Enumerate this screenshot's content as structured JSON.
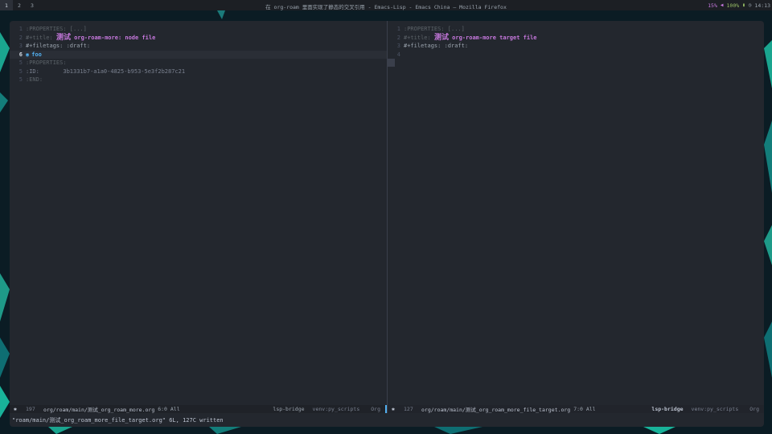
{
  "topbar": {
    "workspaces": [
      "1",
      "2",
      "3"
    ],
    "window_title": "在 org-roam 里面实现了静态的交叉引用 - Emacs-Lisp - Emacs China — Mozilla Firefox",
    "cpu": "15%",
    "volume": "100%",
    "time": "14:13"
  },
  "left_buffer": {
    "lines": [
      {
        "n": "1",
        "text": ":PROPERTIES: [...]"
      },
      {
        "n": "2",
        "kw": "#+title: ",
        "zh": "测试",
        "rest": " org-roam-more: node file"
      },
      {
        "n": "3",
        "text": "#+filetags: :draft:"
      },
      {
        "n": "6",
        "bullet": "◉",
        "text": "foo"
      },
      {
        "n": "5",
        "text": ":PROPERTIES:"
      },
      {
        "n": "5",
        "text": ":ID:       3b1331b7-a1a0-4825-b953-5e3f2b287c21"
      },
      {
        "n": "5",
        "text": ":END:"
      }
    ]
  },
  "right_buffer": {
    "lines": [
      {
        "n": "1",
        "text": ":PROPERTIES: [...]"
      },
      {
        "n": "2",
        "kw": "#+title: ",
        "zh": "测试",
        "rest": " org-roam-more target file"
      },
      {
        "n": "3",
        "text": "#+filetags: :draft:"
      },
      {
        "n": "4",
        "text": ""
      }
    ]
  },
  "modeline_left": {
    "icon": "✱",
    "size": "197",
    "path": "org/roam/main/测试_org_roam_more.org",
    "pos": "6:0 All",
    "lsp": "lsp-bridge",
    "venv": "venv:py_scripts",
    "mode": "Org"
  },
  "modeline_right": {
    "icon": "✱",
    "size": "127",
    "path": "org/roam/main/测试_org_roam_more_file_target.org",
    "pos": "7:0 All",
    "lsp": "lsp-bridge",
    "venv": "venv:py_scripts",
    "mode": "Org"
  },
  "echo": "\"roam/main/测试_org_roam_more_file_target.org\" 6L, 127C written",
  "colors": {
    "frame_bg": "#23272e",
    "accent": "#51afef",
    "title": "#c678dd"
  }
}
